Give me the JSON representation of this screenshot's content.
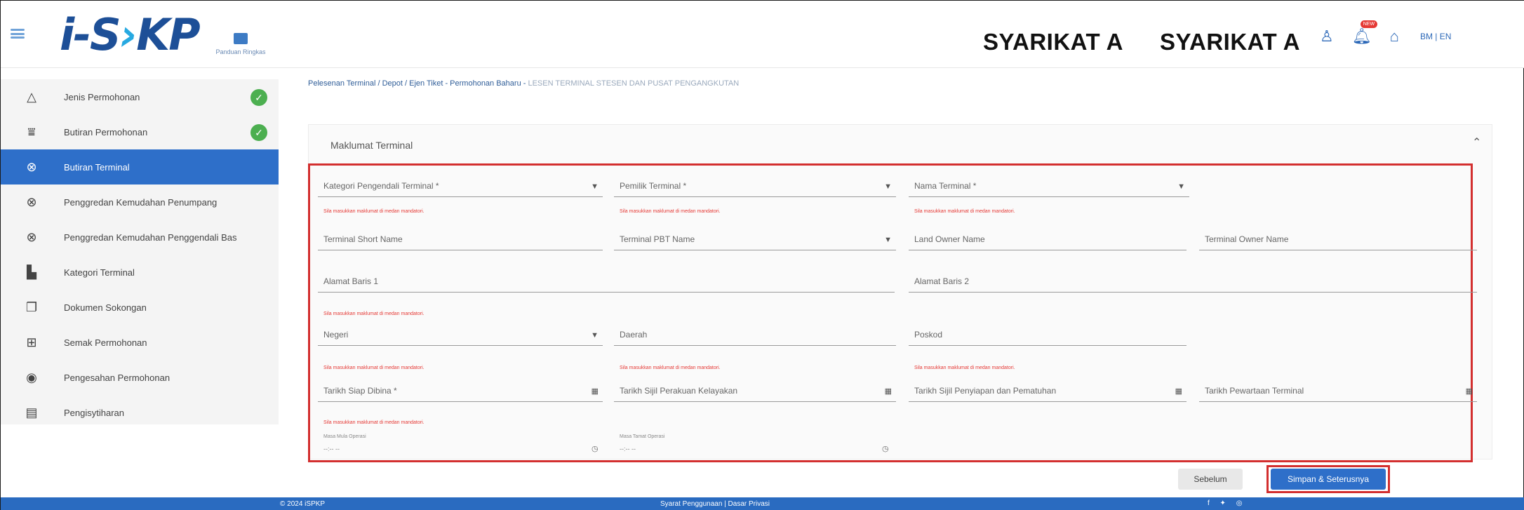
{
  "header": {
    "logo_main": "i-S",
    "logo_tail": "KP",
    "guide_label": "Panduan Ringkas",
    "company_1": "SYARIKAT A",
    "company_2": "SYARIKAT A",
    "notif_badge": "NEW",
    "language": "BM | EN",
    "icons": [
      "user-icon",
      "bell-icon",
      "home-icon"
    ]
  },
  "sidebar": {
    "items": [
      {
        "label": "Jenis Permohonan",
        "icon": "warning-icon",
        "done": true
      },
      {
        "label": "Butiran Permohonan",
        "icon": "filter-icon",
        "done": true
      },
      {
        "label": "Butiran Terminal",
        "icon": "route-icon",
        "done": false,
        "active": true
      },
      {
        "label": "Penggredan Kemudahan Penumpang",
        "icon": "route-icon",
        "done": false
      },
      {
        "label": "Penggredan Kemudahan Penggendali Bas",
        "icon": "route-icon",
        "done": false
      },
      {
        "label": "Kategori Terminal",
        "icon": "document-icon",
        "done": false
      },
      {
        "label": "Dokumen Sokongan",
        "icon": "files-icon",
        "done": false
      },
      {
        "label": "Semak Permohonan",
        "icon": "plus-box-icon",
        "done": false
      },
      {
        "label": "Pengesahan Permohonan",
        "icon": "badge-icon",
        "done": false
      },
      {
        "label": "Pengisytiharan",
        "icon": "list-icon",
        "done": false
      }
    ]
  },
  "breadcrumb": {
    "path": "Pelesenan Terminal / Depot / Ejen Tiket - Permohonan Baharu - ",
    "current": "LESEN TERMINAL STESEN DAN PUSAT PENGANGKUTAN"
  },
  "section_title": "Maklumat Terminal",
  "error_message": "Sila masukkan maklumat di medan mandatori.",
  "fields": {
    "kategori": "Kategori Pengendali Terminal *",
    "pemilik": "Pemilik Terminal *",
    "nama": "Nama Terminal *",
    "short_name": "Terminal Short Name",
    "pbt_name": "Terminal PBT Name",
    "land_owner": "Land Owner Name",
    "terminal_owner": "Terminal Owner Name",
    "alamat1": "Alamat Baris 1",
    "alamat2": "Alamat Baris 2",
    "negeri": "Negeri",
    "daerah": "Daerah",
    "poskod": "Poskod",
    "tarikh_siap": "Tarikh Siap Dibina *",
    "tarikh_sijil_kelayakan": "Tarikh Sijil Perakuan Kelayakan",
    "tarikh_sijil_penyiapan": "Tarikh Sijil Penyiapan dan Pematuhan",
    "tarikh_pewartaan": "Tarikh Pewartaan Terminal",
    "masa_mula": "Masa Mula Operasi",
    "masa_tamat": "Masa Tamat Operasi",
    "time_placeholder": "--:-- --"
  },
  "buttons": {
    "prev": "Sebelum",
    "save_next": "Simpan & Seterusnya"
  },
  "footer": {
    "copyright": "© 2024 iSPKP",
    "links": "Syarat Penggunaan | Dasar Privasi",
    "social": "f ✦ ◎"
  },
  "colors": {
    "primary": "#2e6fc9",
    "error": "#d32f2f",
    "success": "#4caf50"
  }
}
